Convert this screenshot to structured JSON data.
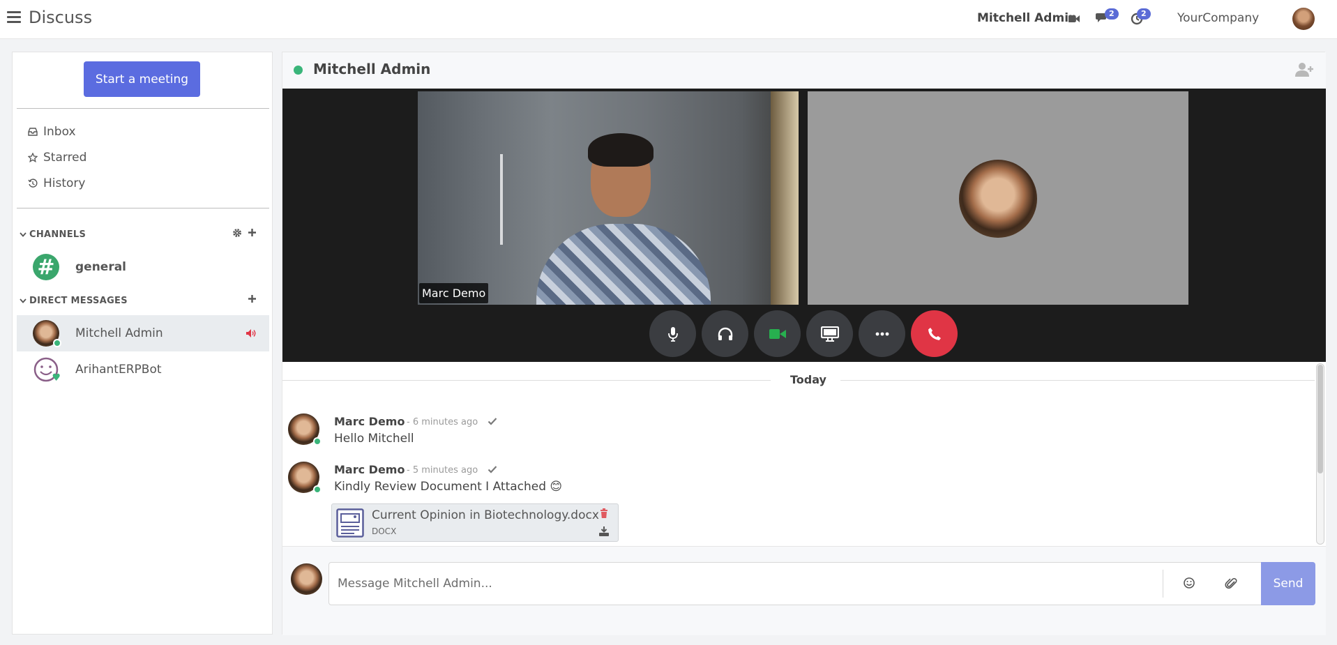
{
  "navbar": {
    "app_title": "Discuss",
    "user_name": "Mitchell Admin",
    "messages_badge": "2",
    "activity_badge": "2",
    "company": "YourCompany"
  },
  "sidebar": {
    "start_meeting": "Start a meeting",
    "mailboxes": [
      {
        "label": "Inbox",
        "icon": "inbox-icon"
      },
      {
        "label": "Starred",
        "icon": "star-icon"
      },
      {
        "label": "History",
        "icon": "history-icon"
      }
    ],
    "channels_header": "CHANNELS",
    "channels": [
      {
        "name": "general",
        "icon": "hash-icon"
      }
    ],
    "dm_header": "DIRECT MESSAGES",
    "direct_messages": [
      {
        "name": "Mitchell Admin",
        "active": true,
        "in_call": true
      },
      {
        "name": "ArihantERPBot",
        "active": false
      }
    ]
  },
  "thread": {
    "title": "Mitchell Admin",
    "status": "online",
    "call": {
      "participants": [
        {
          "label": "Marc Demo",
          "video": true
        },
        {
          "label": "",
          "video": false
        }
      ],
      "controls": [
        "microphone-icon",
        "headphones-icon",
        "video-camera-icon",
        "screen-share-icon",
        "more-options-icon",
        "hang-up-icon"
      ]
    },
    "day_separator": "Today",
    "messages": [
      {
        "author": "Marc Demo",
        "date": "- 6 minutes ago",
        "body": "Hello Mitchell"
      },
      {
        "author": "Marc Demo",
        "date": "- 5 minutes ago",
        "body": "Kindly Review Document I Attached 😊",
        "attachment": {
          "name": "Current Opinion in Biotechnology.docx",
          "ext": "DOCX"
        }
      }
    ],
    "composer": {
      "placeholder": "Message Mitchell Admin...",
      "send_label": "Send"
    }
  },
  "colors": {
    "primary": "#5b6ce0",
    "online": "#3ab57a",
    "hangup": "#e03545",
    "send_disabled": "#8c9ae6"
  }
}
